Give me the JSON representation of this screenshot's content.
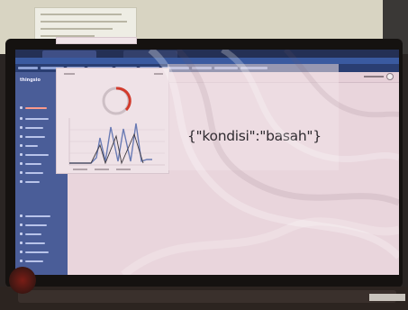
{
  "sidebar": {
    "brand": "thingsio"
  },
  "message": {
    "json_text": "{\"kondisi\":\"basah\"}"
  },
  "colors": {
    "sidebar": "#4a5d98",
    "gauge_accent": "#d23a2c",
    "screen_bg": "#e9d5dc"
  }
}
